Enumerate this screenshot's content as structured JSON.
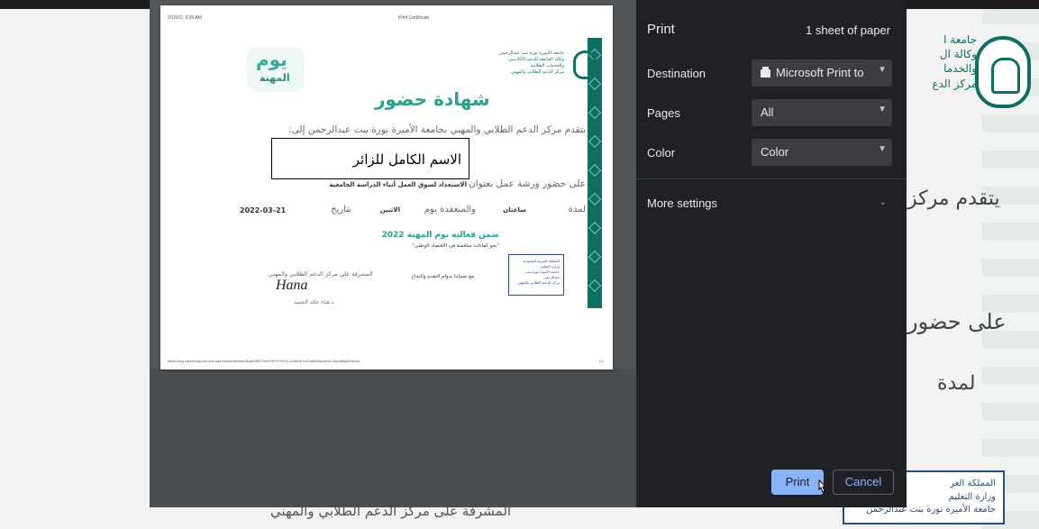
{
  "background": {
    "university_lines": [
      "جامعة ا",
      "وكالة ال",
      "والخدما",
      "مركز الدع"
    ],
    "line_intro": "يتقدم مركز",
    "line_attend": "على حضور",
    "line_duration": "لمدة",
    "bottom_text": "المشرفة على مركز الدعم الطلابي والمهني",
    "ministry_lines": [
      "المملكة العر",
      "وزارة التعليم",
      "جامعة الأميرة نورة بنت عبدالرحمن"
    ]
  },
  "preview": {
    "header_date": "3/18/22, 9:26 AM",
    "header_title": "Print Certificate",
    "footer_url": "https://reg.careerday.pnu.edu.sa/print/certificate/8DyB1BEC9ocPePF9YhOL2U5drWYxS4b8E0qc6ecAJ3A4d5fgDPmlAA",
    "footer_page": "1/1",
    "certificate": {
      "logo_line1": "يوم",
      "logo_line2": "المهنة",
      "university_lines": [
        "جامعة الأميرة نورة بنت عبدالرحمن",
        "وكالة الجامعة للدعم الأكاديمي",
        "والخدمات الطلابية",
        "مركز الدعم الطلابي والمهني"
      ],
      "title": "شهادة حضور",
      "intro": "يتقدم مركز الدعم الطلابي والمهني بجامعة الأميرة نورة بنت عبدالرحمن إلى:",
      "attend": "على حضور ورشة عمل بعنوان",
      "workshop": "الاستعداد لسوق العمل أثناء الدراسة الجامعية",
      "duration_label": "لمدة",
      "duration_value": "ساعتان",
      "held_label": "والمنعقدة يوم",
      "day": "الاثنين",
      "date_label": "بتاريخ",
      "date": "2022-03-21",
      "event": "ضمن فعالية يوم المهنة 2022",
      "slogan": "\"نحو كفاءات منافسة في الاقتصاد الوطني\"",
      "wish": "مع تمنياتنا بدوام التقدم والنجاح",
      "supervisor_title": "المشرفة على مركز الدعم الطلابي والمهني",
      "signature": "Hana",
      "supervisor_name": "د.هناء خالد الحميد",
      "ministry_lines": [
        "المملكة العربية السعودية",
        "وزارة التعليم",
        "جامعة الأميرة نورة بنت عبدالرحمن",
        "مركز الدعم الطلابي والمهني"
      ]
    },
    "name_overlay": "الاسم الكامل للزائر"
  },
  "panel": {
    "title": "Print",
    "sheet_count": "1 sheet of paper",
    "destination_label": "Destination",
    "destination_value": "Microsoft Print to",
    "pages_label": "Pages",
    "pages_value": "All",
    "color_label": "Color",
    "color_value": "Color",
    "more_settings": "More settings",
    "print_button": "Print",
    "cancel_button": "Cancel"
  },
  "colors": {
    "panel_bg": "#202124",
    "select_bg": "#3c3d40",
    "primary_button": "#8ab4f8",
    "certificate_teal": "#0d6e63",
    "certificate_title": "#2aa18f"
  },
  "icons": [
    "printer-icon",
    "chevron-down-icon",
    "mouse-cursor-icon",
    "university-seal-icon",
    "ministry-logo-icon"
  ]
}
